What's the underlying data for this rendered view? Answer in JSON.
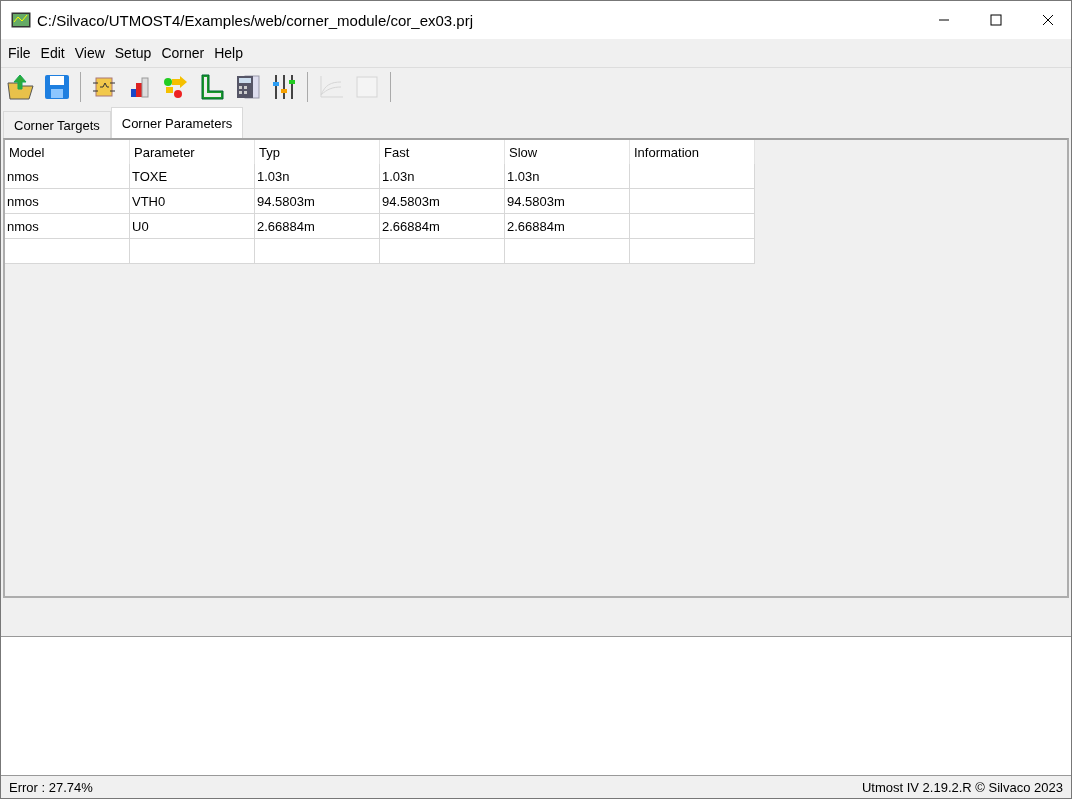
{
  "window": {
    "title": "C:/Silvaco/UTMOST4/Examples/web/corner_module/cor_ex03.prj"
  },
  "menu": [
    "File",
    "Edit",
    "View",
    "Setup",
    "Corner",
    "Help"
  ],
  "toolbar": [
    {
      "kind": "open",
      "disabled": false
    },
    {
      "kind": "save",
      "disabled": false
    },
    {
      "kind": "sep"
    },
    {
      "kind": "module",
      "disabled": false
    },
    {
      "kind": "bars",
      "disabled": false
    },
    {
      "kind": "flow",
      "disabled": false
    },
    {
      "kind": "ruler",
      "disabled": false
    },
    {
      "kind": "calculator",
      "disabled": false
    },
    {
      "kind": "sliders",
      "disabled": false
    },
    {
      "kind": "sep"
    },
    {
      "kind": "plot",
      "disabled": true
    },
    {
      "kind": "page",
      "disabled": true
    },
    {
      "kind": "sep"
    }
  ],
  "tabs": [
    {
      "label": "Corner Targets",
      "selected": false
    },
    {
      "label": "Corner Parameters",
      "selected": true
    }
  ],
  "table": {
    "columns": [
      "Model",
      "Parameter",
      "Typ",
      "Fast",
      "Slow",
      "Information"
    ],
    "rows": [
      [
        "nmos",
        "TOXE",
        "1.03n",
        "1.03n",
        "1.03n"
      ],
      [
        "nmos",
        "VTH0",
        "94.5803m",
        "94.5803m",
        "94.5803m"
      ],
      [
        "nmos",
        "U0",
        "2.66884m",
        "2.66884m",
        "2.66884m"
      ]
    ]
  },
  "status_bar": {
    "left": "Error : 27.74%",
    "right": "Utmost IV 2.19.2.R © Silvaco 2023"
  }
}
